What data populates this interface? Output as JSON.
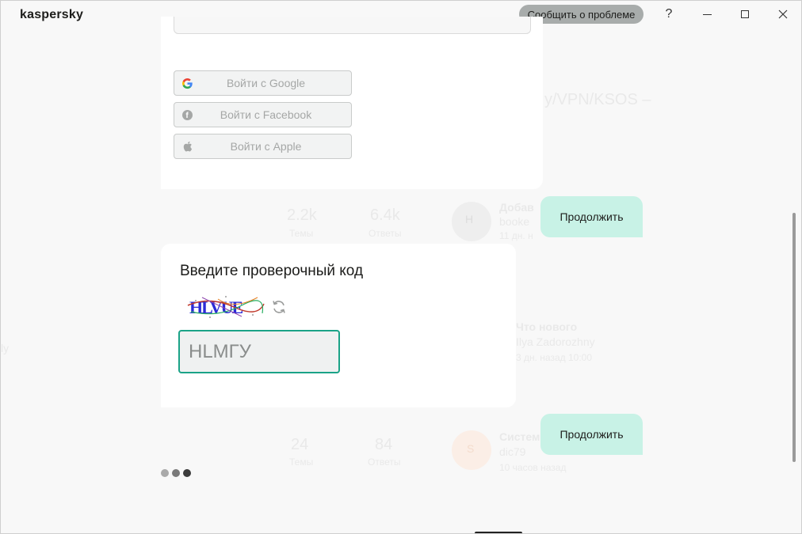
{
  "app": {
    "logo": "kaspersky",
    "report_label": "Сообщить о проблеме",
    "help_label": "?"
  },
  "background": {
    "feed_title": "y/VPN/KSOS –",
    "stats_1": {
      "topics_value": "2.2k",
      "topics_label": "Темы",
      "replies_value": "6.4k",
      "replies_label": "Ответы"
    },
    "post_1": {
      "avatar": "H",
      "title": "Добав",
      "author": "booke",
      "time": "11 дн. н"
    },
    "post_2": {
      "title": "Что нового",
      "author": "Ilya Zadorozhny",
      "time": "3 дн. назад 10:00"
    },
    "stats_2": {
      "topics_value": "24",
      "topics_label": "Темы",
      "replies_value": "84",
      "replies_label": "Ответы"
    },
    "post_3": {
      "avatar": "S",
      "title": "Систем",
      "author": "dic79",
      "time": "10 часов назад"
    },
    "side_text": "ly"
  },
  "login": {
    "buttons": [
      {
        "label": "Войти с Google",
        "icon": "google-icon"
      },
      {
        "label": "Войти с Facebook",
        "icon": "facebook-icon"
      },
      {
        "label": "Войти с Apple",
        "icon": "apple-icon"
      }
    ]
  },
  "captcha": {
    "title": "Введите проверочный код",
    "input_value": "HLMГУ",
    "image_text": "HLVUE"
  },
  "continue": {
    "label_1": "Продолжить",
    "label_2": "Продолжить"
  },
  "pager": {
    "dots": 3,
    "active_index": 2,
    "colors": [
      "#a9a9a9",
      "#7a7a7a",
      "#3c3c3c"
    ]
  },
  "colors": {
    "accent": "#1ba387",
    "continue_bg": "#c8f2e6",
    "report_bg": "#a8acab"
  }
}
